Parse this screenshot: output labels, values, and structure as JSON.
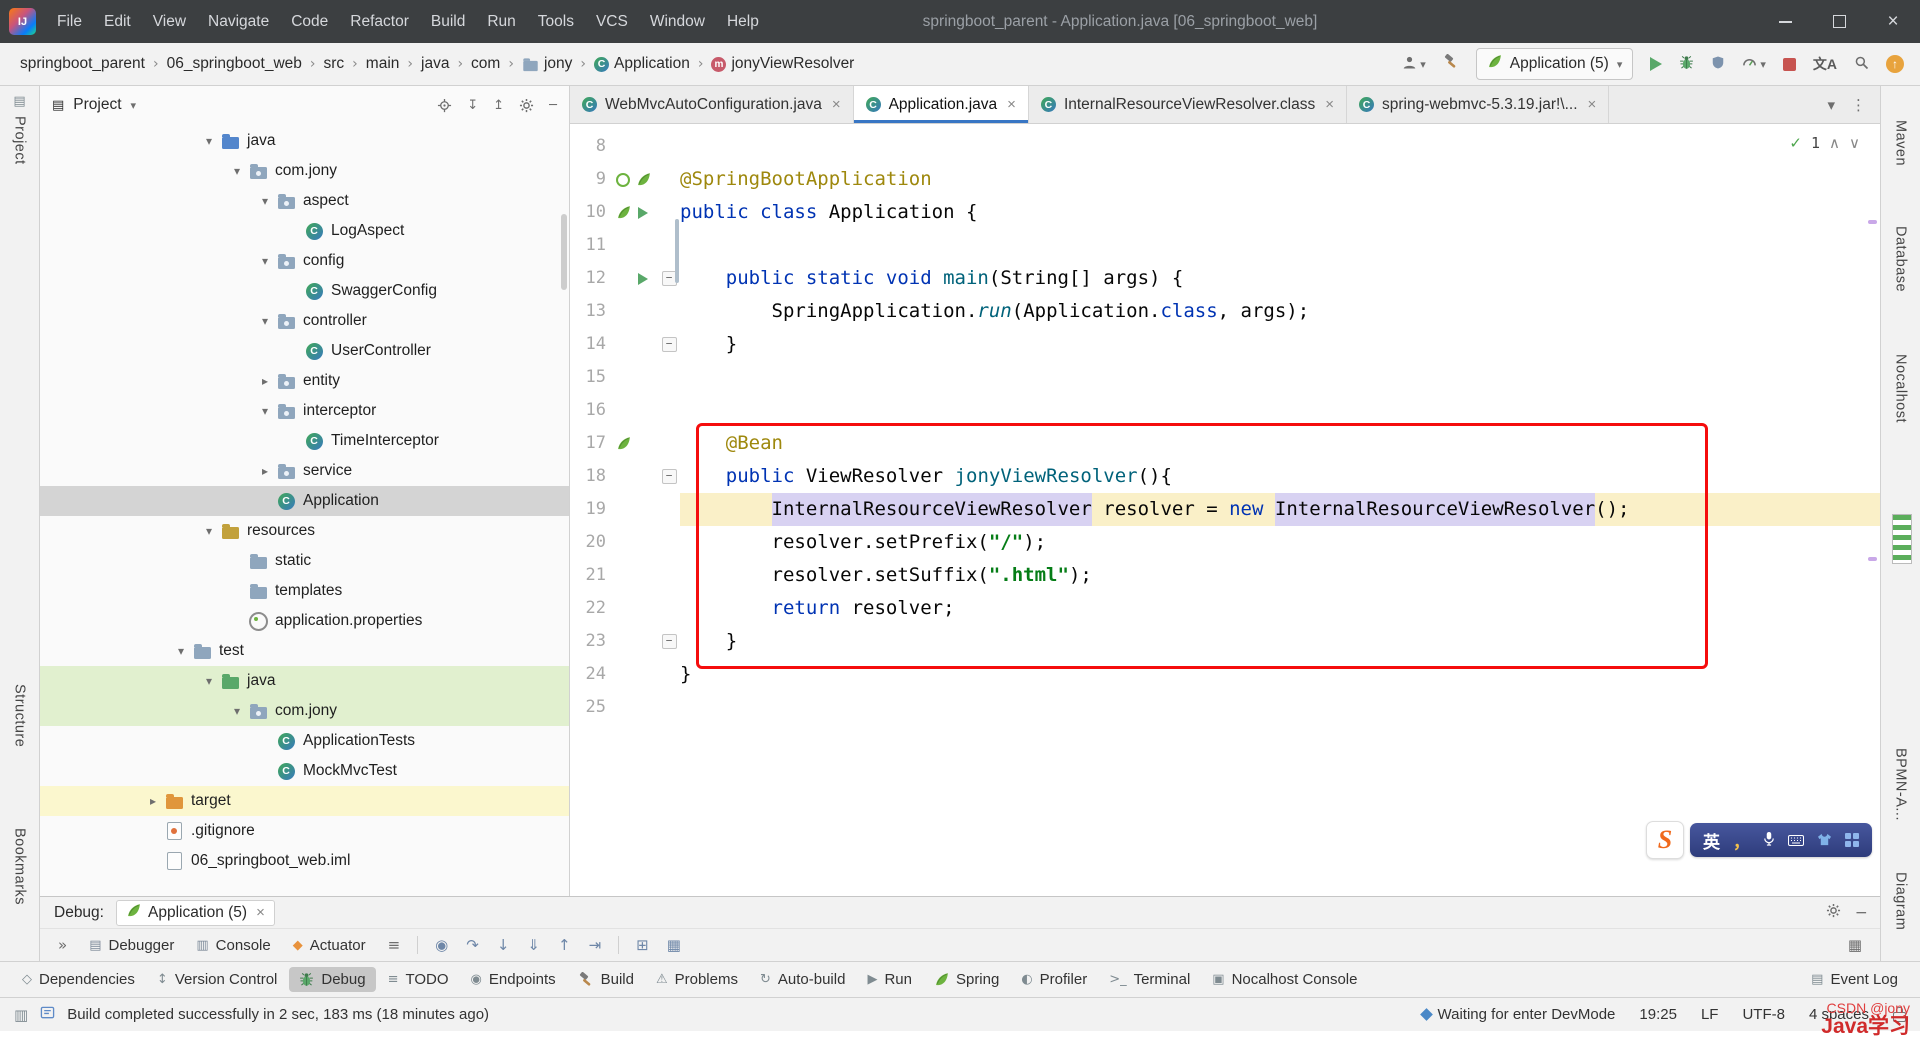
{
  "titlebar": {
    "menus": [
      "File",
      "Edit",
      "View",
      "Navigate",
      "Code",
      "Refactor",
      "Build",
      "Run",
      "Tools",
      "VCS",
      "Window",
      "Help"
    ],
    "title": "springboot_parent - Application.java [06_springboot_web]"
  },
  "navbar": {
    "breadcrumbs": [
      {
        "label": "springboot_parent"
      },
      {
        "label": "06_springboot_web"
      },
      {
        "label": "src"
      },
      {
        "label": "main"
      },
      {
        "label": "java"
      },
      {
        "label": "com"
      },
      {
        "label": "jony",
        "icon": "folder"
      },
      {
        "label": "Application",
        "icon": "class"
      },
      {
        "label": "jonyViewResolver",
        "icon": "method"
      }
    ],
    "run_config": "Application (5)"
  },
  "left_stripe": {
    "project": "Project",
    "structure": "Structure",
    "bookmarks": "Bookmarks"
  },
  "right_stripe": {
    "maven": "Maven",
    "database": "Database",
    "nocalhost": "Nocalhost",
    "bpmn": "BPMN-A...",
    "diagram": "Diagram"
  },
  "project_panel": {
    "title": "Project",
    "tree": [
      {
        "label": "java",
        "level": 5,
        "chevron": "open",
        "icon": "folder-src"
      },
      {
        "label": "com.jony",
        "level": 6,
        "chevron": "open",
        "icon": "package"
      },
      {
        "label": "aspect",
        "level": 7,
        "chevron": "open",
        "icon": "package"
      },
      {
        "label": "LogAspect",
        "level": 8,
        "icon": "class"
      },
      {
        "label": "config",
        "level": 7,
        "chevron": "open",
        "icon": "package"
      },
      {
        "label": "SwaggerConfig",
        "level": 8,
        "icon": "class"
      },
      {
        "label": "controller",
        "level": 7,
        "chevron": "open",
        "icon": "package"
      },
      {
        "label": "UserController",
        "level": 8,
        "icon": "class"
      },
      {
        "label": "entity",
        "level": 7,
        "chevron": "closed",
        "icon": "package"
      },
      {
        "label": "interceptor",
        "level": 7,
        "chevron": "open",
        "icon": "package"
      },
      {
        "label": "TimeInterceptor",
        "level": 8,
        "icon": "class"
      },
      {
        "label": "service",
        "level": 7,
        "chevron": "closed",
        "icon": "package"
      },
      {
        "label": "Application",
        "level": 7,
        "icon": "class",
        "highlight": "selected"
      },
      {
        "label": "resources",
        "level": 5,
        "chevron": "open",
        "icon": "folder-res"
      },
      {
        "label": "static",
        "level": 6,
        "icon": "folder"
      },
      {
        "label": "templates",
        "level": 6,
        "icon": "folder"
      },
      {
        "label": "application.properties",
        "level": 6,
        "icon": "props"
      },
      {
        "label": "test",
        "level": 4,
        "chevron": "open",
        "icon": "folder"
      },
      {
        "label": "java",
        "level": 5,
        "chevron": "open",
        "icon": "folder-test",
        "highlight": "green"
      },
      {
        "label": "com.jony",
        "level": 6,
        "chevron": "open",
        "icon": "package",
        "highlight": "green"
      },
      {
        "label": "ApplicationTests",
        "level": 7,
        "icon": "class"
      },
      {
        "label": "MockMvcTest",
        "level": 7,
        "icon": "class"
      },
      {
        "label": "target",
        "level": 3,
        "chevron": "closed",
        "icon": "folder-excl",
        "highlight": "yellow"
      },
      {
        "label": ".gitignore",
        "level": 3,
        "icon": "file-git"
      },
      {
        "label": "06_springboot_web.iml",
        "level": 3,
        "icon": "file"
      }
    ]
  },
  "editor": {
    "tabs": [
      {
        "label": "WebMvcAutoConfiguration.java"
      },
      {
        "label": "Application.java",
        "active": true
      },
      {
        "label": "InternalResourceViewResolver.class"
      },
      {
        "label": "spring-webmvc-5.3.19.jar!\\..."
      }
    ],
    "inspection_count": "1",
    "lines": [
      {
        "n": "8",
        "tokens": []
      },
      {
        "n": "9",
        "gutter": [
          "bean",
          "spring"
        ],
        "tokens": [
          [
            "@SpringBootApplication",
            "ann"
          ]
        ]
      },
      {
        "n": "10",
        "gutter": [
          "spring",
          "run"
        ],
        "tokens": [
          [
            "public class ",
            "kw"
          ],
          [
            "Application {",
            "p"
          ]
        ]
      },
      {
        "n": "11",
        "tokens": []
      },
      {
        "n": "12",
        "gutter": [
          "blank",
          "run"
        ],
        "fold": "minus",
        "tokens": [
          [
            "    ",
            "p"
          ],
          [
            "public static void ",
            "kw"
          ],
          [
            "main",
            "md"
          ],
          [
            "(String[] args) {",
            "p"
          ]
        ]
      },
      {
        "n": "13",
        "tokens": [
          [
            "        ",
            "p"
          ],
          [
            "SpringApplication.",
            "p"
          ],
          [
            "run",
            "sm"
          ],
          [
            "(Application.",
            "p"
          ],
          [
            "class",
            "kw"
          ],
          [
            ", args);",
            "p"
          ]
        ]
      },
      {
        "n": "14",
        "fold": "minus",
        "tokens": [
          [
            "    }",
            "p"
          ]
        ]
      },
      {
        "n": "15",
        "tokens": []
      },
      {
        "n": "16",
        "tokens": []
      },
      {
        "n": "17",
        "gutter": [
          "spring"
        ],
        "tokens": [
          [
            "    ",
            "p"
          ],
          [
            "@Bean",
            "ann"
          ]
        ]
      },
      {
        "n": "18",
        "fold": "minus",
        "tokens": [
          [
            "    ",
            "p"
          ],
          [
            "public ",
            "kw"
          ],
          [
            "ViewResolver ",
            "p"
          ],
          [
            "jonyViewResolver",
            "md"
          ],
          [
            "(){",
            "p"
          ]
        ]
      },
      {
        "n": "19",
        "hl": true,
        "tokens": [
          [
            "        ",
            "p"
          ],
          [
            "InternalResourceViewResolver",
            "ht"
          ],
          [
            " resolver = ",
            "p"
          ],
          [
            "new",
            "kw"
          ],
          [
            " ",
            "p"
          ],
          [
            "InternalResourceViewResolver",
            "ht"
          ],
          [
            "();",
            "p"
          ]
        ]
      },
      {
        "n": "20",
        "tokens": [
          [
            "        ",
            "p"
          ],
          [
            "resolver.setPrefix(",
            "p"
          ],
          [
            "\"/\"",
            "str"
          ],
          [
            ");",
            "p"
          ]
        ]
      },
      {
        "n": "21",
        "tokens": [
          [
            "        ",
            "p"
          ],
          [
            "resolver.setSuffix(",
            "p"
          ],
          [
            "\".html\"",
            "str"
          ],
          [
            ");",
            "p"
          ]
        ]
      },
      {
        "n": "22",
        "tokens": [
          [
            "        ",
            "p"
          ],
          [
            "return",
            "kw"
          ],
          [
            " resolver;",
            "p"
          ]
        ]
      },
      {
        "n": "23",
        "fold": "minus",
        "tokens": [
          [
            "    }",
            "p"
          ]
        ]
      },
      {
        "n": "24",
        "tokens": [
          [
            "}",
            "p"
          ]
        ]
      },
      {
        "n": "25",
        "tokens": []
      }
    ]
  },
  "debug_panel": {
    "label": "Debug:",
    "session_tab": "Application (5)",
    "tabs": [
      {
        "label": "Debugger"
      },
      {
        "label": "Console"
      },
      {
        "label": "Actuator"
      }
    ]
  },
  "toolwindow_bar": {
    "items": [
      {
        "label": "Dependencies",
        "icon": "dependencies-icon"
      },
      {
        "label": "Version Control",
        "icon": "vcs-icon"
      },
      {
        "label": "Debug",
        "icon": "debug-icon",
        "active": true
      },
      {
        "label": "TODO",
        "icon": "todo-icon"
      },
      {
        "label": "Endpoints",
        "icon": "endpoints-icon"
      },
      {
        "label": "Build",
        "icon": "build-icon"
      },
      {
        "label": "Problems",
        "icon": "problems-icon"
      },
      {
        "label": "Auto-build",
        "icon": "autobuild-icon"
      },
      {
        "label": "Run",
        "icon": "run-icon"
      },
      {
        "label": "Spring",
        "icon": "spring-icon"
      },
      {
        "label": "Profiler",
        "icon": "profiler-icon"
      },
      {
        "label": "Terminal",
        "icon": "terminal-icon"
      },
      {
        "label": "Nocalhost Console",
        "icon": "nocalhost-icon"
      }
    ],
    "right_item": {
      "label": "Event Log",
      "icon": "eventlog-icon"
    }
  },
  "status_bar": {
    "message": "Build completed successfully in 2 sec, 183 ms (18 minutes ago)",
    "devmode": "Waiting for enter DevMode",
    "time": "19:25",
    "line_ending": "LF",
    "encoding": "UTF-8",
    "indent": "4 spaces"
  },
  "ime": {
    "lang": "英",
    "punct": "，"
  },
  "watermark": {
    "line1": "CSDN @jony",
    "line2": "Java学习"
  }
}
